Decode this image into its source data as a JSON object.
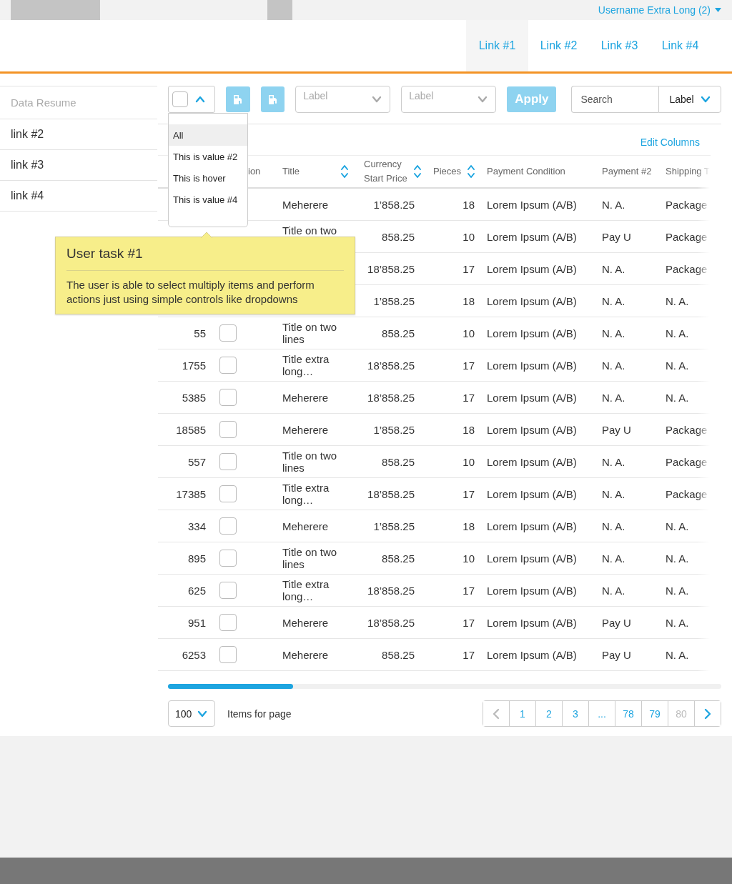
{
  "top_bar": {
    "user_menu": "Username Extra Long (2)"
  },
  "nav": {
    "links": [
      {
        "label": "Link #1",
        "selected": true
      },
      {
        "label": "Link #2",
        "selected": false
      },
      {
        "label": "Link #3",
        "selected": false
      },
      {
        "label": "Link #4",
        "selected": false
      }
    ]
  },
  "sidebar": {
    "title": "Data Resume",
    "items": [
      "link #2",
      "link #3",
      "link #4"
    ]
  },
  "toolbar": {
    "select_all": {
      "checked": false,
      "expanded": true
    },
    "filters": [
      {
        "placeholder": "Label"
      },
      {
        "placeholder": "Label"
      }
    ],
    "apply": "Apply",
    "search": {
      "placeholder": "Search",
      "scope": "Label"
    }
  },
  "select_menu": {
    "items": [
      {
        "label": "All",
        "selected": true
      },
      {
        "label": "This is value #2",
        "selected": false
      },
      {
        "label": "This is hover",
        "selected": false
      },
      {
        "label": "This is value #4",
        "selected": false
      }
    ]
  },
  "edit_columns": "Edit Columns",
  "table": {
    "columns": [
      {
        "label": "ion",
        "sortable": false
      },
      {
        "label": "Title",
        "sortable": true
      },
      {
        "label": "Currency Start Price",
        "sortable": true
      },
      {
        "label": "Pieces",
        "sortable": true
      },
      {
        "label": "Payment Condition",
        "sortable": false
      },
      {
        "label": "Payment #2",
        "sortable": false
      },
      {
        "label": "Shipping T",
        "sortable": false
      }
    ],
    "rows": [
      {
        "title": "Meherere",
        "price": "1’858.25",
        "pieces": "18",
        "payment_condition": "Lorem Ipsum (A/B)",
        "payment_2": "N. A.",
        "shipping": "Package"
      },
      {
        "title": "Title on two",
        "price": "858.25",
        "pieces": "10",
        "payment_condition": "Lorem Ipsum (A/B)",
        "payment_2": "Pay U",
        "shipping": "Package"
      },
      {
        "price": "18’858.25",
        "pieces": "17",
        "payment_condition": "Lorem Ipsum (A/B)",
        "payment_2": "N. A.",
        "shipping": "Package"
      },
      {
        "price": "1’858.25",
        "pieces": "18",
        "payment_condition": "Lorem Ipsum (A/B)",
        "payment_2": "N. A.",
        "shipping": "N. A."
      },
      {
        "id": "55",
        "checked": false,
        "title": "Title on two lines",
        "price": "858.25",
        "pieces": "10",
        "payment_condition": "Lorem Ipsum (A/B)",
        "payment_2": "N. A.",
        "shipping": "N. A."
      },
      {
        "id": "1755",
        "checked": false,
        "title": "Title extra long…",
        "price": "18’858.25",
        "pieces": "17",
        "payment_condition": "Lorem Ipsum (A/B)",
        "payment_2": "N. A.",
        "shipping": "N. A."
      },
      {
        "id": "5385",
        "checked": false,
        "title": "Meherere",
        "price": "18’858.25",
        "pieces": "17",
        "payment_condition": "Lorem Ipsum (A/B)",
        "payment_2": "N. A.",
        "shipping": "N. A."
      },
      {
        "id": "18585",
        "checked": false,
        "title": "Meherere",
        "price": "1’858.25",
        "pieces": "18",
        "payment_condition": "Lorem Ipsum (A/B)",
        "payment_2": "Pay U",
        "shipping": "Package"
      },
      {
        "id": "557",
        "checked": false,
        "title": "Title on two lines",
        "price": "858.25",
        "pieces": "10",
        "payment_condition": "Lorem Ipsum (A/B)",
        "payment_2": "N. A.",
        "shipping": "Package"
      },
      {
        "id": "17385",
        "checked": false,
        "title": "Title extra long…",
        "price": "18’858.25",
        "pieces": "17",
        "payment_condition": "Lorem Ipsum (A/B)",
        "payment_2": "N. A.",
        "shipping": "Package"
      },
      {
        "id": "334",
        "checked": false,
        "title": "Meherere",
        "price": "1’858.25",
        "pieces": "18",
        "payment_condition": "Lorem Ipsum (A/B)",
        "payment_2": "N. A.",
        "shipping": "N. A."
      },
      {
        "id": "895",
        "checked": false,
        "title": "Title on two lines",
        "price": "858.25",
        "pieces": "10",
        "payment_condition": "Lorem Ipsum (A/B)",
        "payment_2": "N. A.",
        "shipping": "N. A."
      },
      {
        "id": "625",
        "checked": false,
        "title": "Title extra long…",
        "price": "18’858.25",
        "pieces": "17",
        "payment_condition": "Lorem Ipsum (A/B)",
        "payment_2": "N. A.",
        "shipping": "N. A."
      },
      {
        "id": "951",
        "checked": false,
        "title": "Meherere",
        "price": "18’858.25",
        "pieces": "17",
        "payment_condition": "Lorem Ipsum (A/B)",
        "payment_2": "Pay U",
        "shipping": "N. A."
      },
      {
        "id": "6253",
        "checked": false,
        "title": "Meherere",
        "price": "858.25",
        "pieces": "17",
        "payment_condition": "Lorem Ipsum (A/B)",
        "payment_2": "Pay U",
        "shipping": "N. A."
      }
    ]
  },
  "pager": {
    "per_page": "100",
    "per_page_label": "Items for page",
    "prev": {
      "disabled": true
    },
    "next": {
      "disabled": false
    },
    "pages": [
      {
        "label": "1",
        "disabled": false
      },
      {
        "label": "2",
        "disabled": false
      },
      {
        "label": "3",
        "disabled": false
      },
      {
        "label": "...",
        "disabled": false
      },
      {
        "label": "78",
        "disabled": false
      },
      {
        "label": "79",
        "disabled": false
      },
      {
        "label": "80",
        "disabled": true
      }
    ]
  },
  "task_note": {
    "title": "User task #1",
    "body": "The user is able to select multiply items and perform actions just using simple controls like dropdowns"
  }
}
